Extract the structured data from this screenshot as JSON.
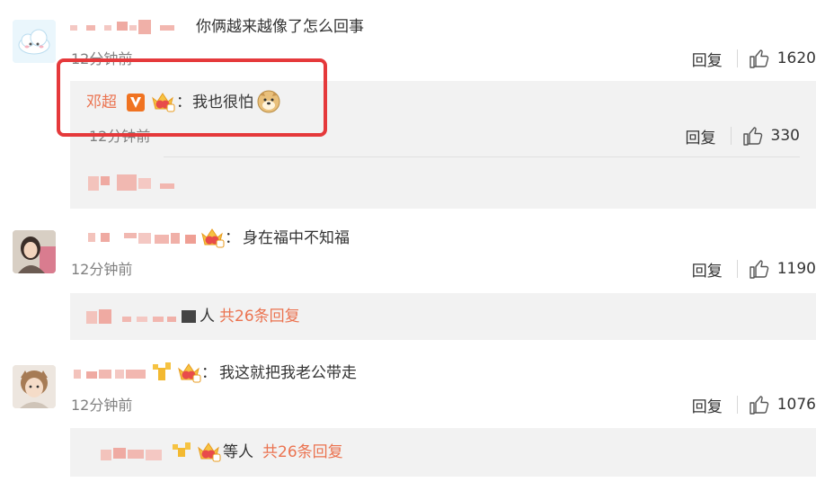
{
  "comments": [
    {
      "text": "你俩越来越像了怎么回事",
      "time": "12分钟前",
      "reply_label": "回复",
      "likes": "1620",
      "sub_reply": {
        "author": "邓超",
        "colon": "：",
        "text": "我也很怕",
        "time": "12分钟前",
        "reply_label": "回复",
        "likes": "330"
      }
    },
    {
      "colon": "：",
      "text": "身在福中不知福",
      "time": "12分钟前",
      "reply_label": "回复",
      "likes": "1190",
      "thread_suffix": "人",
      "thread_count": "共26条回复"
    },
    {
      "colon": "：",
      "text": "我这就把我老公带走",
      "time": "12分钟前",
      "reply_label": "回复",
      "likes": "1076",
      "thread_suffix": "等人",
      "thread_count": "共26条回复"
    }
  ],
  "colors": {
    "accent": "#eb7350",
    "highlight_box": "#e5393b",
    "reply_bg": "#f2f2f2"
  },
  "icons": [
    "thumbs-up-icon",
    "verified-v-badge-icon",
    "crown-badge-icon",
    "doge-emoji-icon"
  ]
}
